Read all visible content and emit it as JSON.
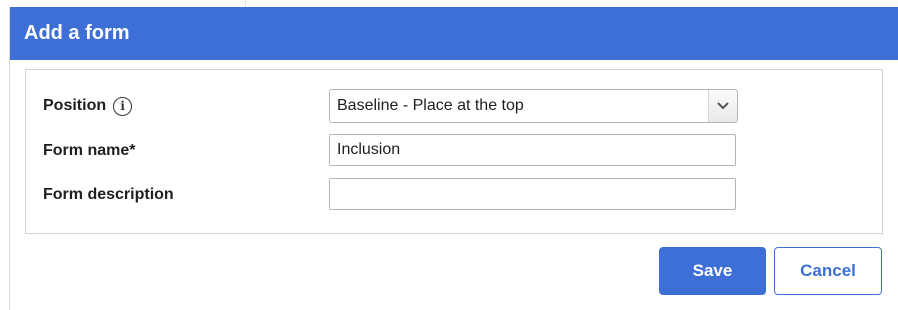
{
  "dialog": {
    "title": "Add a form",
    "accent_color": "#3e6fd6"
  },
  "form": {
    "position": {
      "label": "Position",
      "info_icon": "info-icon",
      "selected_value": "Baseline - Place at the top"
    },
    "form_name": {
      "label": "Form name*",
      "value": "Inclusion"
    },
    "form_description": {
      "label": "Form description",
      "value": ""
    }
  },
  "actions": {
    "save_label": "Save",
    "cancel_label": "Cancel"
  }
}
